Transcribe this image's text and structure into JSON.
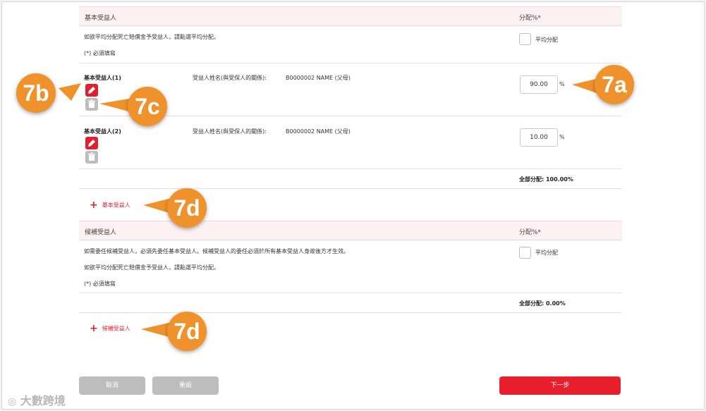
{
  "primary": {
    "title": "基本受益人",
    "pct_header": "分配%*",
    "note": "如欲平均分配死亡賠償金予受益人，請點選平均分配。",
    "required": "(*) 必須填寫",
    "equal_label": "平均分配",
    "beneficiaries": [
      {
        "label": "基本受益人(1)",
        "field": "受益人姓名(與受保人的關係):",
        "name": "B0000002 NAME (父母)",
        "pct": "90.00"
      },
      {
        "label": "基本受益人(2)",
        "field": "受益人姓名(與受保人的關係):",
        "name": "B0000002 NAME (父母)",
        "pct": "10.00"
      }
    ],
    "pct_unit": "%",
    "total": "全部分配: 100.00%",
    "add": "基本受益人"
  },
  "contingent": {
    "title": "候補受益人",
    "pct_header": "分配%*",
    "note1": "如需委任候補受益人，必須先委任基本受益人。候補受益人的委任必須於所有基本受益人身故後方才生效。",
    "note2": "如欲平均分配死亡賠償金予受益人，請點選平均分配。",
    "required": "(*) 必須填寫",
    "equal_label": "平均分配",
    "total": "全部分配: 0.00%",
    "add": "候補受益人"
  },
  "buttons": {
    "cancel": "取消",
    "reset": "重設",
    "next": "下一步"
  },
  "callouts": {
    "c7a": "7a",
    "c7b": "7b",
    "c7c": "7c",
    "c7d_1": "7d",
    "c7d_2": "7d"
  },
  "watermark": "大數跨境",
  "colors": {
    "accent": "#e0202e",
    "callout": "#f0922b",
    "header_bg": "#fdf1f2"
  }
}
